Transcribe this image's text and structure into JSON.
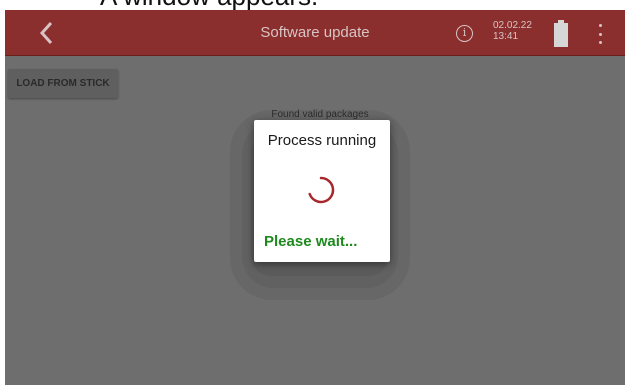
{
  "caption": "A window appears.",
  "header": {
    "title": "Software update",
    "date": "02.02.22",
    "time": "13:41",
    "back_icon": "chevron-left-icon",
    "info_icon": "info-icon",
    "info_glyph": "i",
    "battery_icon": "battery-icon",
    "menu_icon": "more-vert-icon"
  },
  "toolbar": {
    "load_label": "LOAD FROM STICK"
  },
  "background_dialog": {
    "text": "Found valid packages"
  },
  "dialog": {
    "title": "Process running",
    "status": "Please wait...",
    "spinner_icon": "loading-spinner-icon"
  },
  "colors": {
    "header_bg": "#8b2e2e",
    "overlay": "#6e6e6e",
    "spinner": "#a8272c",
    "status_text": "#1e8a1e"
  }
}
